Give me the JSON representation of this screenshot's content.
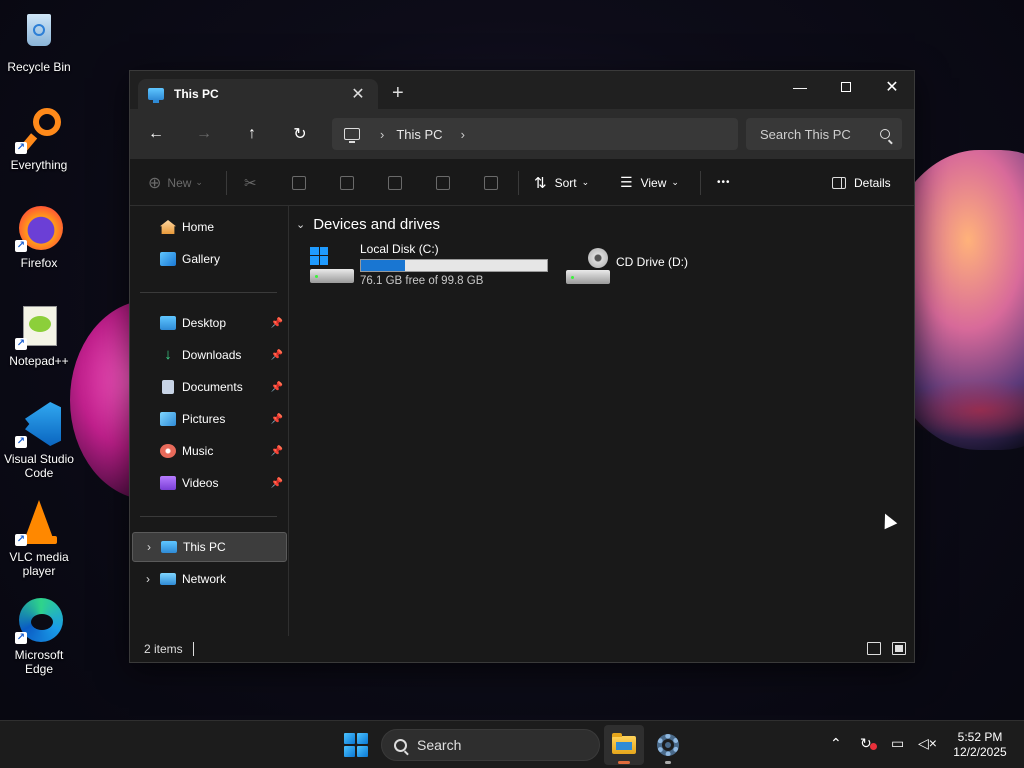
{
  "desktop": {
    "icons": [
      {
        "label": "Recycle Bin",
        "icon": "recycle-bin-icon"
      },
      {
        "label": "Everything",
        "icon": "everything-search-icon"
      },
      {
        "label": "Firefox",
        "icon": "firefox-icon"
      },
      {
        "label": "Notepad++",
        "icon": "notepad-plus-plus-icon"
      },
      {
        "label": "Visual Studio Code",
        "icon": "vscode-icon"
      },
      {
        "label": "VLC media player",
        "icon": "vlc-icon"
      },
      {
        "label": "Microsoft Edge",
        "icon": "edge-icon"
      }
    ]
  },
  "window": {
    "tab_title": "This PC",
    "address": {
      "crumb": "This PC"
    },
    "search_placeholder": "Search This PC",
    "toolbar": {
      "new_label": "New",
      "sort_label": "Sort",
      "view_label": "View",
      "more_label": "•••",
      "details_label": "Details"
    },
    "sidebar": {
      "quick": [
        {
          "label": "Home",
          "icon": "home-icon"
        },
        {
          "label": "Gallery",
          "icon": "gallery-icon"
        }
      ],
      "pinned": [
        {
          "label": "Desktop",
          "icon": "desktop-folder-icon"
        },
        {
          "label": "Downloads",
          "icon": "downloads-icon"
        },
        {
          "label": "Documents",
          "icon": "documents-icon"
        },
        {
          "label": "Pictures",
          "icon": "pictures-icon"
        },
        {
          "label": "Music",
          "icon": "music-icon"
        },
        {
          "label": "Videos",
          "icon": "videos-icon"
        }
      ],
      "locations": [
        {
          "label": "This PC",
          "icon": "this-pc-icon",
          "selected": true
        },
        {
          "label": "Network",
          "icon": "network-icon",
          "selected": false
        }
      ]
    },
    "content": {
      "group_label": "Devices and drives",
      "drives": [
        {
          "name": "Local Disk (C:)",
          "free_text": "76.1 GB free of 99.8 GB",
          "used_fraction": 0.238
        },
        {
          "name": "CD Drive (D:)"
        }
      ]
    },
    "status": {
      "items_text": "2 items"
    }
  },
  "taskbar": {
    "search_label": "Search",
    "clock_time": "5:52 PM",
    "clock_date": "12/2/2025"
  },
  "colors": {
    "accent": "#1976d2",
    "window_bg": "#191919",
    "taskbar_bg": "#1c1c1c"
  }
}
